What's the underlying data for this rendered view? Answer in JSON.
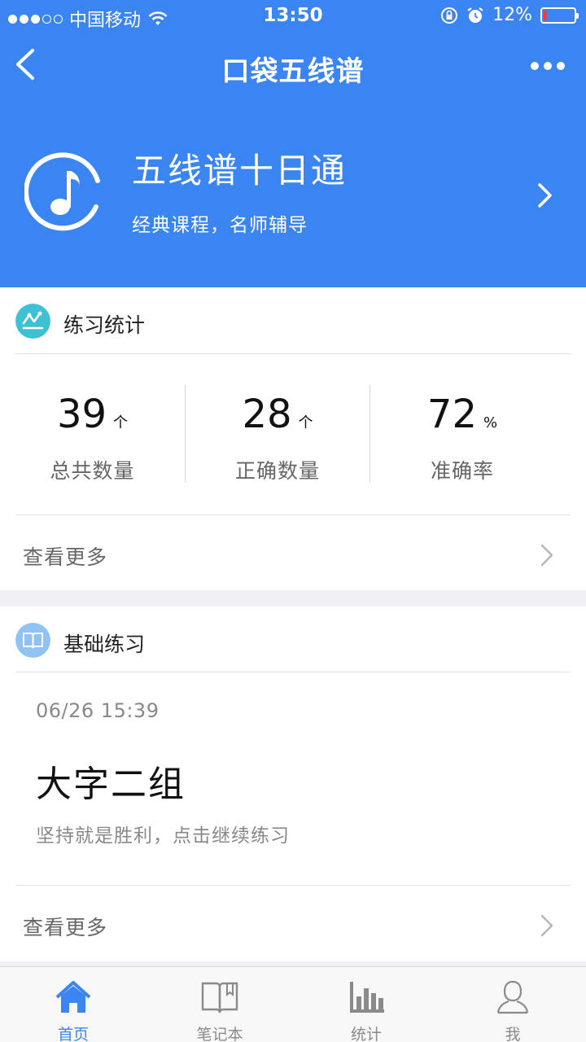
{
  "status_bar": {
    "carrier": "中国移动",
    "time": "13:50",
    "battery": "12%",
    "battery_level": 0.12
  },
  "nav": {
    "title": "口袋五线谱"
  },
  "course": {
    "title": "五线谱十日通",
    "subtitle": "经典课程，名师辅导"
  },
  "stats_card": {
    "title": "练习统计",
    "stats": [
      {
        "value": "39",
        "unit": "个",
        "label": "总共数量"
      },
      {
        "value": "28",
        "unit": "个",
        "label": "正确数量"
      },
      {
        "value": "72",
        "unit": "%",
        "label": "准确率"
      }
    ],
    "more_label": "查看更多"
  },
  "practice_card": {
    "title": "基础练习",
    "date": "06/26 15:39",
    "item_title": "大字二组",
    "item_desc": "坚持就是胜利，点击继续练习",
    "more_label": "查看更多"
  },
  "tabbar": {
    "tabs": [
      {
        "label": "首页",
        "active": true
      },
      {
        "label": "笔记本",
        "active": false
      },
      {
        "label": "统计",
        "active": false
      },
      {
        "label": "我",
        "active": false
      }
    ]
  },
  "colors": {
    "primary": "#3a85f2",
    "stats_icon": "#3dc1d3",
    "practice_icon": "#8fc2f5",
    "inactive_tab": "#8a8a8a"
  }
}
